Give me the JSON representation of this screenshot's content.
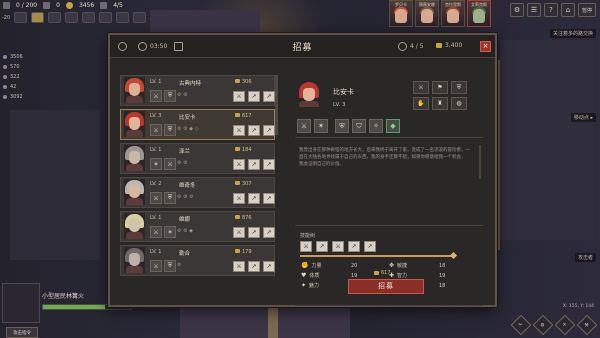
{
  "hud": {
    "food": "0 / 200",
    "unit_count": "0",
    "gold": "3456",
    "population": "4/5",
    "row2_value": "-20"
  },
  "portraits": [
    {
      "name": "罗贝卡"
    },
    {
      "name": "薇薇安娜"
    },
    {
      "name": "克拉里斯"
    },
    {
      "name": "艾莉克斯"
    }
  ],
  "top_icons": [
    "⚙",
    "☰",
    "?",
    "⌂"
  ],
  "top_icons_label": "暂停",
  "resources": [
    "3506",
    "570",
    "322",
    "42",
    "3092"
  ],
  "hints": [
    {
      "text": "关注着多的路交换"
    },
    {
      "text": "移动点 ▸"
    },
    {
      "text": "攻击者"
    }
  ],
  "modal": {
    "title": "招募",
    "timer": "03:50",
    "slots": "4 / 5",
    "gold": "3,400",
    "close": "×"
  },
  "recruits": [
    {
      "level": "LV. 1",
      "name": "古典内特",
      "cost": "306",
      "hair": "#c24a32",
      "skin": "#e0b094",
      "selected": false,
      "traits": [
        "⚔",
        "⛨"
      ],
      "marks": "⚙ ⚙"
    },
    {
      "level": "LV. 3",
      "name": "比安卡",
      "cost": "617",
      "hair": "#b8382e",
      "skin": "#e3b39a",
      "selected": true,
      "traits": [
        "⚔",
        "⛨"
      ],
      "marks": "⚙ ⚙ ◆ ◇"
    },
    {
      "level": "LV. 1",
      "name": "泽兰",
      "cost": "184",
      "hair": "#9a9792",
      "skin": "#c9b8a8",
      "selected": false,
      "traits": [
        "✶",
        "⚔"
      ],
      "marks": "⚙ ⚙"
    },
    {
      "level": "LV. 2",
      "name": "维奇冬",
      "cost": "307",
      "hair": "#bdb6b0",
      "skin": "#d8b7a0",
      "selected": false,
      "traits": [
        "⚔",
        "⛨"
      ],
      "marks": "⚙ ⚙ ⚙"
    },
    {
      "level": "LV. 1",
      "name": "维娜",
      "cost": "876",
      "hair": "#d8cfa0",
      "skin": "#cfc3a8",
      "selected": false,
      "traits": [
        "⚔",
        "✶"
      ],
      "marks": "⚙ ⚙ ◆"
    },
    {
      "level": "LV. 1",
      "name": "勒合",
      "cost": "179",
      "hair": "#6e6a6a",
      "skin": "#bcb2aa",
      "selected": false,
      "traits": [
        "⚔",
        "⛨"
      ],
      "marks": "⚙"
    }
  ],
  "detail": {
    "name": "比安卡",
    "level": "LV. 3",
    "icons": [
      "⚔",
      "⚑",
      "⛨",
      "✋",
      "♜",
      "◍"
    ],
    "traits": [
      "⚔",
      "✶",
      "⛨",
      "⛉",
      "✧",
      "◆"
    ],
    "description": [
      "我曾出身在那种奇怪的地方长大，后来我终于离开了家，变成了一名流浪的冒险者，一",
      "直在大陆各地寻找属于自己的东西。我的身手还算不错，如果你愿意给我一个机会，",
      "我会证明自己的价值。"
    ],
    "skills_label": "技能树",
    "skills": [
      "⚔",
      "↗",
      "⚔",
      "↗",
      "↗"
    ],
    "stats": [
      {
        "icon": "✊",
        "label": "力量",
        "value": "20"
      },
      {
        "icon": "✥",
        "label": "敏捷",
        "value": "18"
      },
      {
        "icon": "♥",
        "label": "体质",
        "value": "19"
      },
      {
        "icon": "✚",
        "label": "智力",
        "value": "19"
      },
      {
        "icon": "✦",
        "label": "魅力",
        "value": "25"
      },
      {
        "icon": "✧",
        "label": "感知",
        "value": "18"
      }
    ],
    "cost": "617",
    "recruit_button": "招募"
  },
  "unit_panel": {
    "name": "小型居民林篝火",
    "hp_percent": 70,
    "skill_label": "攻击指令"
  },
  "coords": "X: 155, Y: 144",
  "bottom_buttons": [
    "✂",
    "⚙",
    "✕",
    "⚒"
  ]
}
